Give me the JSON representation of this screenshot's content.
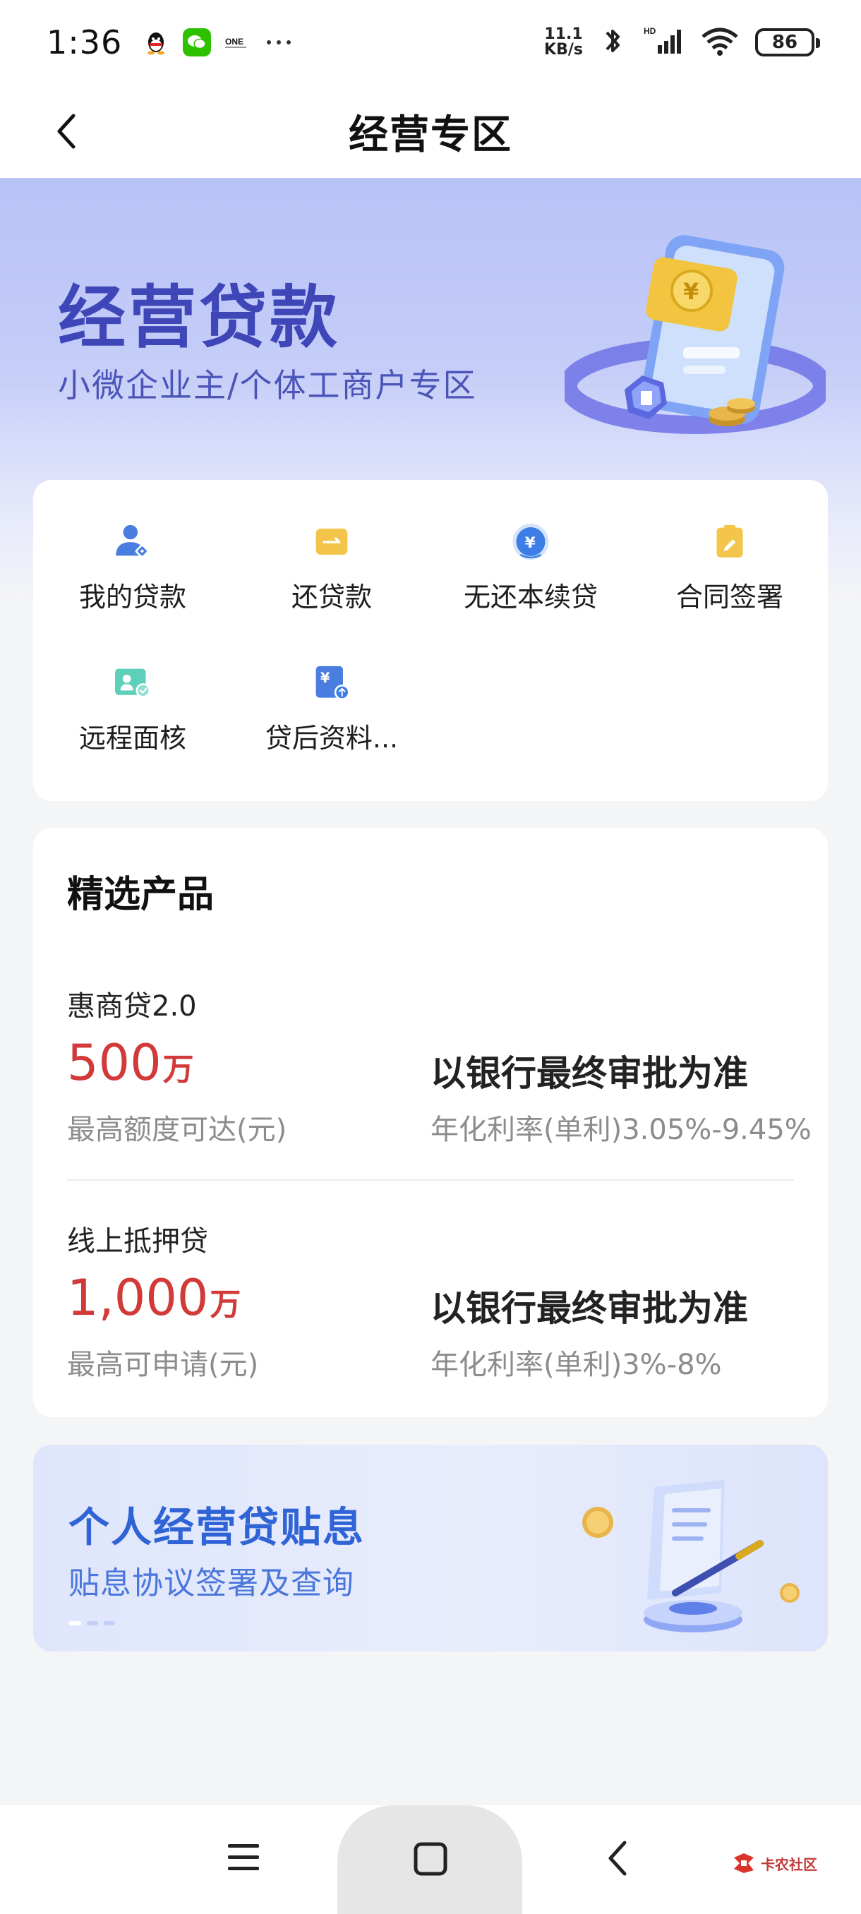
{
  "status_bar": {
    "time": "1:36",
    "app_icons": [
      "qq-icon",
      "wechat-icon",
      "one-icon",
      "more-dots-icon"
    ],
    "net_speed_value": "11.1",
    "net_speed_unit": "KB/s",
    "battery": "86"
  },
  "header": {
    "title": "经营专区"
  },
  "hero": {
    "title": "经营贷款",
    "subtitle": "小微企业主/个体工商户专区"
  },
  "services": [
    {
      "label": "我的贷款",
      "icon": "user-loan-icon"
    },
    {
      "label": "还贷款",
      "icon": "repay-arrow-icon"
    },
    {
      "label": "无还本续贷",
      "icon": "yuan-coin-icon"
    },
    {
      "label": "合同签署",
      "icon": "contract-sign-icon"
    },
    {
      "label": "远程面核",
      "icon": "remote-verify-icon"
    },
    {
      "label": "贷后资料...",
      "icon": "upload-doc-icon"
    }
  ],
  "products_section": {
    "title": "精选产品",
    "items": [
      {
        "name": "惠商贷2.0",
        "amount": "500",
        "unit": "万",
        "amount_caption": "最高额度可达(元)",
        "approval": "以银行最终审批为准",
        "rate": "年化利率(单利)3.05%-9.45%"
      },
      {
        "name": "线上抵押贷",
        "amount": "1,000",
        "unit": "万",
        "amount_caption": "最高可申请(元)",
        "approval": "以银行最终审批为准",
        "rate": "年化利率(单利)3%-8%"
      }
    ]
  },
  "subsidy_banner": {
    "title": "个人经营贷贴息",
    "subtitle": "贴息协议签署及查询"
  },
  "watermark": {
    "text": "卡农社区"
  },
  "colors": {
    "brand_blue": "#3f46b8",
    "link_blue": "#2f63d6",
    "amount_red": "#d23a3a",
    "icon_blue": "#4a7de0",
    "icon_yellow": "#f3c64b",
    "icon_teal": "#5ecfb9"
  }
}
